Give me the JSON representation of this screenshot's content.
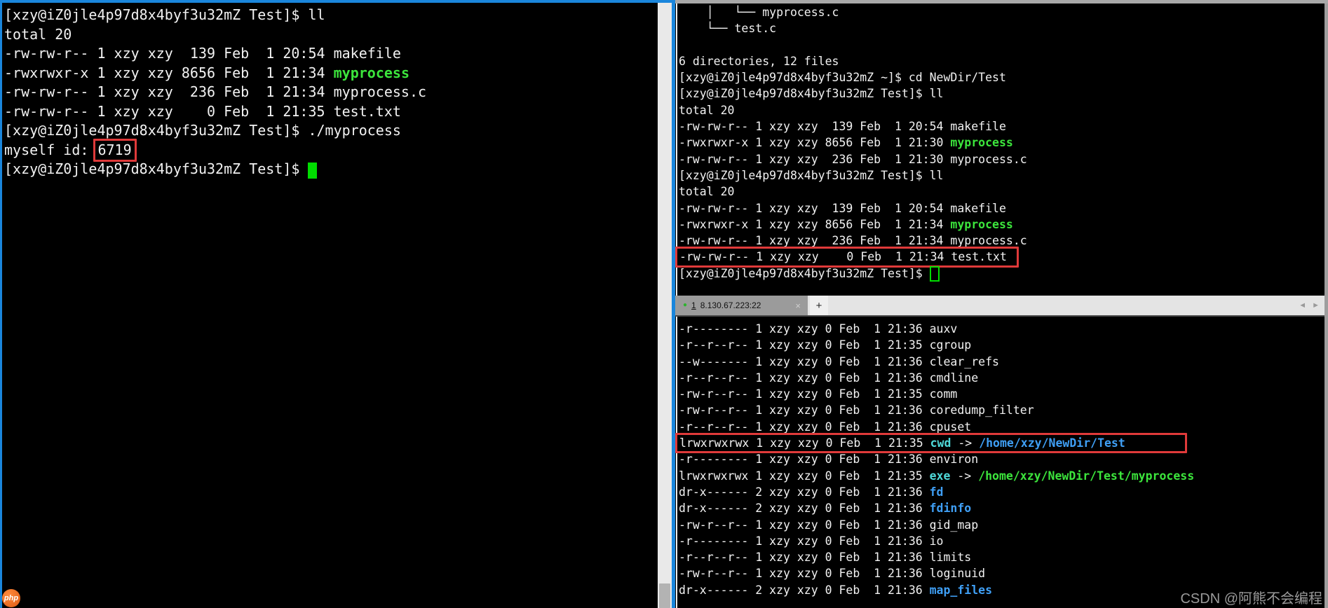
{
  "palette": {
    "terminal_bg": "#000000",
    "text": "#f2f2f2",
    "green": "#3ce53c",
    "cyan": "#4fd9d9",
    "blue": "#3f9ff5",
    "annotation_red": "#e03a3a",
    "cursor_green": "#00dd00",
    "window_border_blue": "#1a86dc",
    "tab_active_bg": "#9b9b9b",
    "tab_bar_bg": "#e4e4e4",
    "tab_dot_green": "#2db32d",
    "watermark_gray": "#9a9a9a"
  },
  "left_terminal": {
    "lines": [
      {
        "segments": [
          {
            "t": "[xzy@iZ0jle4p97d8x4byf3u32mZ Test]$ ll"
          }
        ]
      },
      {
        "segments": [
          {
            "t": "total 20"
          }
        ]
      },
      {
        "segments": [
          {
            "t": "-rw-rw-r-- 1 xzy xzy  139 Feb  1 20:54 makefile"
          }
        ]
      },
      {
        "segments": [
          {
            "t": "-rwxrwxr-x 1 xzy xzy 8656 Feb  1 21:34 "
          },
          {
            "t": "myprocess",
            "c": "green",
            "b": true
          }
        ]
      },
      {
        "segments": [
          {
            "t": "-rw-rw-r-- 1 xzy xzy  236 Feb  1 21:34 myprocess.c"
          }
        ]
      },
      {
        "segments": [
          {
            "t": "-rw-rw-r-- 1 xzy xzy    0 Feb  1 21:35 test.txt"
          }
        ]
      },
      {
        "segments": [
          {
            "t": "[xzy@iZ0jle4p97d8x4byf3u32mZ Test]$ ./myprocess"
          }
        ]
      },
      {
        "segments": [
          {
            "t": "myself id: "
          },
          {
            "t": "6719",
            "box": true
          }
        ]
      },
      {
        "segments": [
          {
            "t": "[xzy@iZ0jle4p97d8x4byf3u32mZ Test]$ "
          },
          {
            "cursor": "block"
          }
        ]
      }
    ]
  },
  "right_top_terminal": {
    "lines": [
      {
        "segments": [
          {
            "t": "    │   └── myprocess.c"
          }
        ]
      },
      {
        "segments": [
          {
            "t": "    └── test.c"
          }
        ]
      },
      {
        "segments": [
          {
            "t": ""
          }
        ]
      },
      {
        "segments": [
          {
            "t": "6 directories, 12 files"
          }
        ]
      },
      {
        "segments": [
          {
            "t": "[xzy@iZ0jle4p97d8x4byf3u32mZ ~]$ cd NewDir/Test"
          }
        ]
      },
      {
        "segments": [
          {
            "t": "[xzy@iZ0jle4p97d8x4byf3u32mZ Test]$ ll"
          }
        ]
      },
      {
        "segments": [
          {
            "t": "total 20"
          }
        ]
      },
      {
        "segments": [
          {
            "t": "-rw-rw-r-- 1 xzy xzy  139 Feb  1 20:54 makefile"
          }
        ]
      },
      {
        "segments": [
          {
            "t": "-rwxrwxr-x 1 xzy xzy 8656 Feb  1 21:30 "
          },
          {
            "t": "myprocess",
            "c": "green",
            "b": true
          }
        ]
      },
      {
        "segments": [
          {
            "t": "-rw-rw-r-- 1 xzy xzy  236 Feb  1 21:30 myprocess.c"
          }
        ]
      },
      {
        "segments": [
          {
            "t": "[xzy@iZ0jle4p97d8x4byf3u32mZ Test]$ ll"
          }
        ]
      },
      {
        "segments": [
          {
            "t": "total 20"
          }
        ]
      },
      {
        "segments": [
          {
            "t": "-rw-rw-r-- 1 xzy xzy  139 Feb  1 20:54 makefile"
          }
        ]
      },
      {
        "segments": [
          {
            "t": "-rwxrwxr-x 1 xzy xzy 8656 Feb  1 21:34 "
          },
          {
            "t": "myprocess",
            "c": "green",
            "b": true
          }
        ]
      },
      {
        "segments": [
          {
            "t": "-rw-rw-r-- 1 xzy xzy  236 Feb  1 21:34 myprocess.c"
          }
        ]
      },
      {
        "box": true,
        "box_pad": 14,
        "segments": [
          {
            "t": "-rw-rw-r-- 1 xzy xzy    0 Feb  1 21:34 test.txt"
          }
        ]
      },
      {
        "segments": [
          {
            "t": "[xzy@iZ0jle4p97d8x4byf3u32mZ Test]$ "
          },
          {
            "cursor": "hollow"
          }
        ]
      }
    ]
  },
  "right_bottom_terminal": {
    "lines": [
      {
        "segments": [
          {
            "t": "-r-------- 1 xzy xzy 0 Feb  1 21:36 auxv"
          }
        ]
      },
      {
        "segments": [
          {
            "t": "-r--r--r-- 1 xzy xzy 0 Feb  1 21:35 cgroup"
          }
        ]
      },
      {
        "segments": [
          {
            "t": "--w------- 1 xzy xzy 0 Feb  1 21:36 clear_refs"
          }
        ]
      },
      {
        "segments": [
          {
            "t": "-r--r--r-- 1 xzy xzy 0 Feb  1 21:36 cmdline"
          }
        ]
      },
      {
        "segments": [
          {
            "t": "-rw-r--r-- 1 xzy xzy 0 Feb  1 21:35 comm"
          }
        ]
      },
      {
        "segments": [
          {
            "t": "-rw-r--r-- 1 xzy xzy 0 Feb  1 21:36 coredump_filter"
          }
        ]
      },
      {
        "segments": [
          {
            "t": "-r--r--r-- 1 xzy xzy 0 Feb  1 21:36 cpuset"
          }
        ]
      },
      {
        "box": true,
        "box_pad": 85,
        "segments": [
          {
            "t": "lrwxrwxrwx 1 xzy xzy 0 Feb  1 21:35 "
          },
          {
            "t": "cwd",
            "c": "cyan",
            "b": true
          },
          {
            "t": " -> "
          },
          {
            "t": "/home/xzy/NewDir/Test",
            "c": "blue",
            "b": true
          }
        ]
      },
      {
        "segments": [
          {
            "t": "-r-------- 1 xzy xzy 0 Feb  1 21:36 environ"
          }
        ]
      },
      {
        "segments": [
          {
            "t": "lrwxrwxrwx 1 xzy xzy 0 Feb  1 21:35 "
          },
          {
            "t": "exe",
            "c": "cyan",
            "b": true
          },
          {
            "t": " -> "
          },
          {
            "t": "/home/xzy/NewDir/Test/myprocess",
            "c": "green",
            "b": true
          }
        ]
      },
      {
        "segments": [
          {
            "t": "dr-x------ 2 xzy xzy 0 Feb  1 21:36 "
          },
          {
            "t": "fd",
            "c": "blue",
            "b": true
          }
        ]
      },
      {
        "segments": [
          {
            "t": "dr-x------ 2 xzy xzy 0 Feb  1 21:36 "
          },
          {
            "t": "fdinfo",
            "c": "blue",
            "b": true
          }
        ]
      },
      {
        "segments": [
          {
            "t": "-rw-r--r-- 1 xzy xzy 0 Feb  1 21:36 gid_map"
          }
        ]
      },
      {
        "segments": [
          {
            "t": "-r-------- 1 xzy xzy 0 Feb  1 21:36 io"
          }
        ]
      },
      {
        "segments": [
          {
            "t": "-r--r--r-- 1 xzy xzy 0 Feb  1 21:36 limits"
          }
        ]
      },
      {
        "segments": [
          {
            "t": "-rw-r--r-- 1 xzy xzy 0 Feb  1 21:36 loginuid"
          }
        ]
      },
      {
        "segments": [
          {
            "t": "dr-x------ 2 xzy xzy 0 Feb  1 21:36 "
          },
          {
            "t": "map_files",
            "c": "blue",
            "b": true
          }
        ]
      }
    ]
  },
  "tab_bar": {
    "dot": "●",
    "tab_index": "1",
    "tab_address": "8.130.67.223:22",
    "close_label": "×",
    "new_tab_label": "+",
    "scroll_left_icon": "◄",
    "scroll_right_icon": "►"
  },
  "watermark": "CSDN @阿熊不会编程",
  "php_badge_label": "php"
}
